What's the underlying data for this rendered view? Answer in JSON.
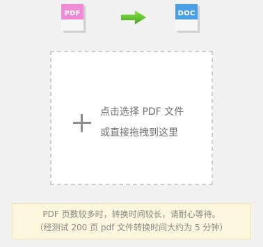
{
  "icons": {
    "source_format": "PDF",
    "target_format": "DOC",
    "source_color": "#f08bd7",
    "target_color": "#4a9fe6",
    "arrow_color": "#5cc22d"
  },
  "dropzone": {
    "line1": "点击选择 PDF 文件",
    "line2": "或直接拖拽到这里"
  },
  "notice": {
    "line1": "PDF 页数较多时，转换时间较长，请耐心等待。",
    "line2": "（经测试 200 页 pdf 文件转换时间大约为 5 分钟）"
  }
}
